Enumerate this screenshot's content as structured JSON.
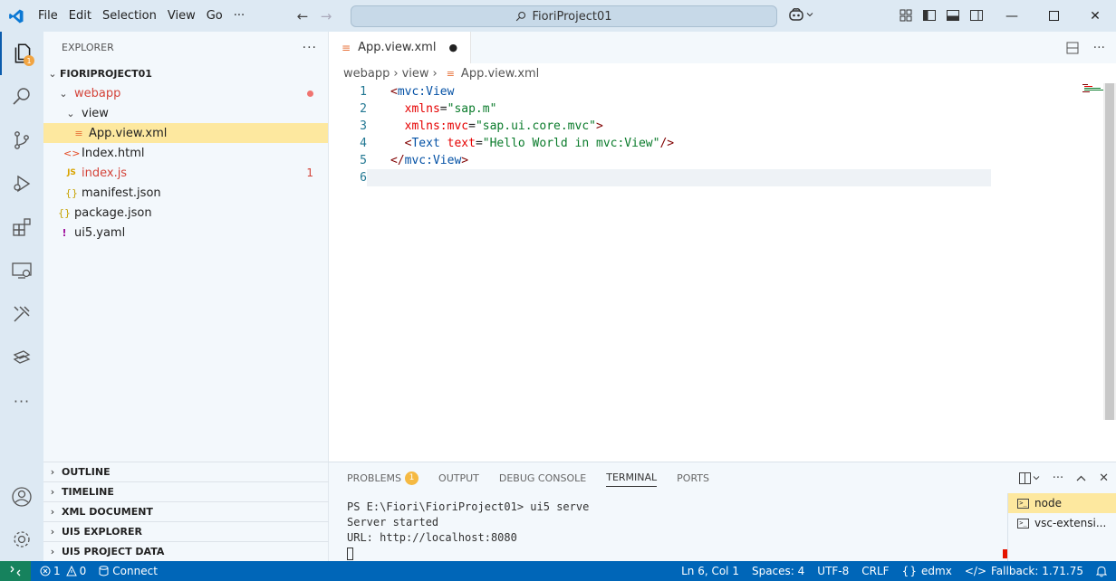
{
  "titlebar": {
    "menu": [
      "File",
      "Edit",
      "Selection",
      "View",
      "Go"
    ],
    "more": "···",
    "search_text": "FioriProject01"
  },
  "explorer": {
    "header": "EXPLORER",
    "more": "···",
    "root": "FIORIPROJECT01",
    "items": [
      {
        "label": "webapp",
        "type": "folder",
        "indicator": "dot"
      },
      {
        "label": "view",
        "type": "folder"
      },
      {
        "label": "App.view.xml",
        "type": "xml",
        "selected": true
      },
      {
        "label": "Index.html",
        "type": "html"
      },
      {
        "label": "index.js",
        "type": "js",
        "problems": "1"
      },
      {
        "label": "manifest.json",
        "type": "json"
      },
      {
        "label": "package.json",
        "type": "json"
      },
      {
        "label": "ui5.yaml",
        "type": "yaml"
      }
    ],
    "icon_glyphs": {
      "xml": "≡",
      "html": "<>",
      "js": "JS",
      "json": "{}",
      "yaml": "!"
    },
    "sections": [
      "OUTLINE",
      "TIMELINE",
      "XML DOCUMENT",
      "UI5 EXPLORER",
      "UI5 PROJECT DATA"
    ]
  },
  "editor": {
    "tab_label": "App.view.xml",
    "tab_modified": "●",
    "breadcrumb": [
      "webapp",
      "view",
      "App.view.xml"
    ],
    "lines": [
      {
        "n": "1",
        "html": "<span class=\"punct\">&lt;</span><span class=\"tagb\">mvc:View</span>"
      },
      {
        "n": "2",
        "html": "  <span class=\"attr\">xmlns</span>=<span class=\"str\">\"sap.m\"</span>"
      },
      {
        "n": "3",
        "html": "  <span class=\"attr\">xmlns:mvc</span>=<span class=\"str\">\"sap.ui.core.mvc\"</span><span class=\"punct\">&gt;</span>"
      },
      {
        "n": "4",
        "html": "  <span class=\"punct\">&lt;</span><span class=\"tagb\">Text</span> <span class=\"attr\">text</span>=<span class=\"str\">\"Hello World in mvc:View\"</span><span class=\"punct\">/&gt;</span>"
      },
      {
        "n": "5",
        "html": "<span class=\"punct\">&lt;/</span><span class=\"tagb\">mvc:View</span><span class=\"punct\">&gt;</span>"
      },
      {
        "n": "6",
        "html": ""
      }
    ]
  },
  "panel": {
    "tabs": [
      "PROBLEMS",
      "OUTPUT",
      "DEBUG CONSOLE",
      "TERMINAL",
      "PORTS"
    ],
    "problems_count": "1",
    "terminal_lines": [
      "PS E:\\Fiori\\FioriProject01> ui5 serve",
      "Server started",
      "URL: http://localhost:8080"
    ],
    "terminals": [
      "node",
      "vsc-extensi..."
    ]
  },
  "statusbar": {
    "errors": "1",
    "warnings": "0",
    "connect": "Connect",
    "position": "Ln 6, Col 1",
    "spaces": "Spaces: 4",
    "encoding": "UTF-8",
    "eol": "CRLF",
    "language": "edmx",
    "fallback": "Fallback: 1.71.75"
  }
}
